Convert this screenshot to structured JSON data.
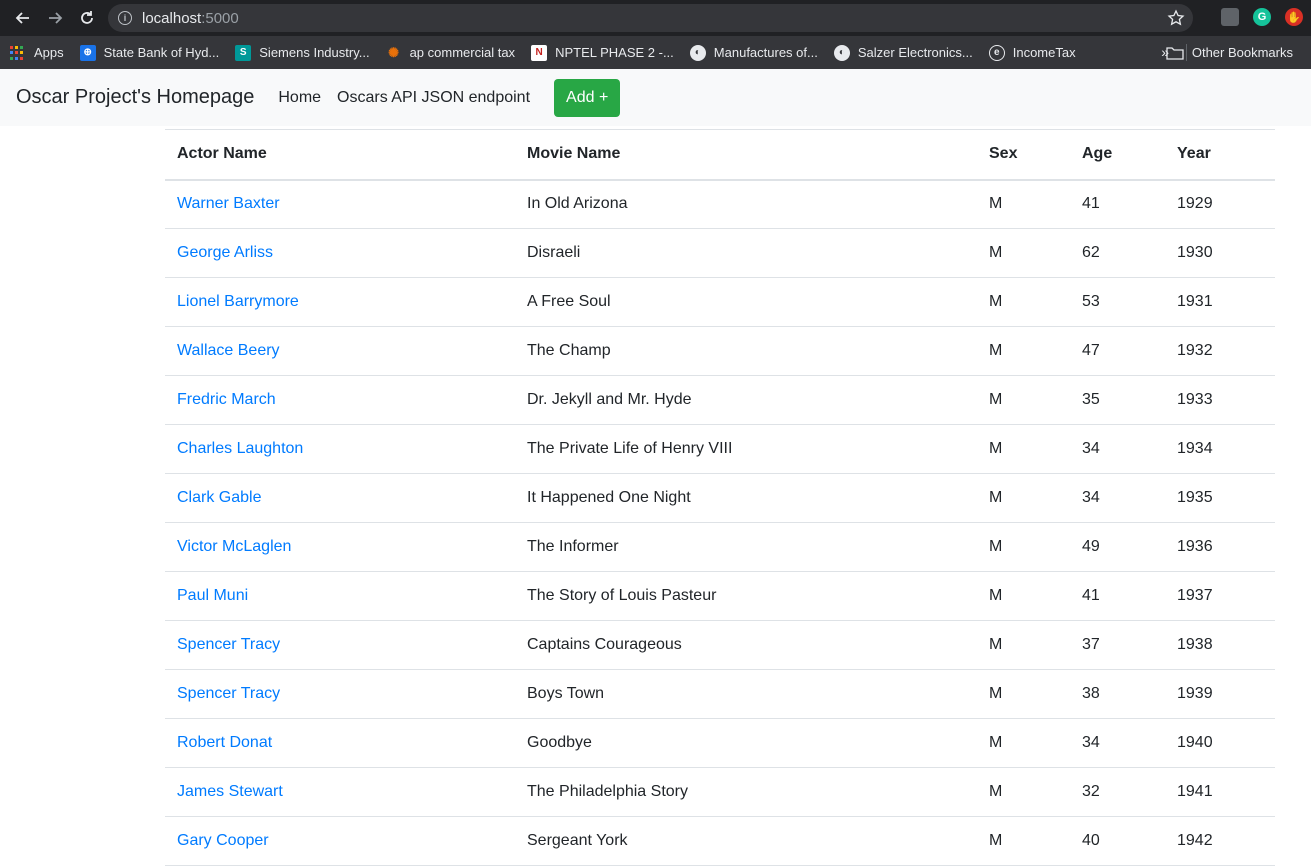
{
  "browser": {
    "url_host": "localhost",
    "url_port": ":5000",
    "bookmarks": [
      {
        "label": "Apps",
        "icon": "apps-grid-icon"
      },
      {
        "label": "State Bank of Hyd...",
        "icon": "sbi-icon"
      },
      {
        "label": "Siemens Industry...",
        "icon": "siemens-icon"
      },
      {
        "label": "ap commercial tax",
        "icon": "ap-tax-icon"
      },
      {
        "label": "NPTEL PHASE 2 -...",
        "icon": "nptel-icon"
      },
      {
        "label": "Manufactures of...",
        "icon": "globe-icon"
      },
      {
        "label": "Salzer Electronics...",
        "icon": "globe-icon"
      },
      {
        "label": "IncomeTax",
        "icon": "incometax-icon"
      }
    ],
    "overflow_label": "»",
    "other_bookmarks": "Other Bookmarks"
  },
  "navbar": {
    "brand": "Oscar Project's Homepage",
    "links": [
      "Home",
      "Oscars API JSON endpoint"
    ],
    "add_button": "Add +",
    "add_color": "#28a745"
  },
  "table": {
    "headers": [
      "Actor Name",
      "Movie Name",
      "Sex",
      "Age",
      "Year"
    ],
    "rows": [
      [
        "Warner Baxter",
        "In Old Arizona",
        "M",
        "41",
        "1929"
      ],
      [
        "George Arliss",
        "Disraeli",
        "M",
        "62",
        "1930"
      ],
      [
        "Lionel Barrymore",
        "A Free Soul",
        "M",
        "53",
        "1931"
      ],
      [
        "Wallace Beery",
        "The Champ",
        "M",
        "47",
        "1932"
      ],
      [
        "Fredric March",
        "Dr. Jekyll and Mr. Hyde",
        "M",
        "35",
        "1933"
      ],
      [
        "Charles Laughton",
        "The Private Life of Henry VIII",
        "M",
        "34",
        "1934"
      ],
      [
        "Clark Gable",
        "It Happened One Night",
        "M",
        "34",
        "1935"
      ],
      [
        "Victor McLaglen",
        "The Informer",
        "M",
        "49",
        "1936"
      ],
      [
        "Paul Muni",
        "The Story of Louis Pasteur",
        "M",
        "41",
        "1937"
      ],
      [
        "Spencer Tracy",
        "Captains Courageous",
        "M",
        "37",
        "1938"
      ],
      [
        "Spencer Tracy",
        "Boys Town",
        "M",
        "38",
        "1939"
      ],
      [
        "Robert Donat",
        "Goodbye",
        "M",
        "34",
        "1940"
      ],
      [
        "James Stewart",
        "The Philadelphia Story",
        "M",
        "32",
        "1941"
      ],
      [
        "Gary Cooper",
        "Sergeant York",
        "M",
        "40",
        "1942"
      ]
    ],
    "link_color": "#007bff"
  }
}
